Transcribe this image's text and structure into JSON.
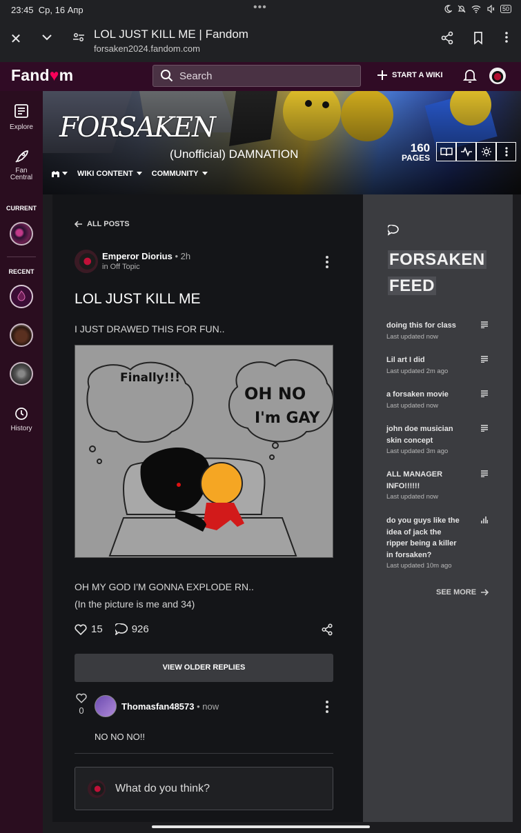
{
  "status": {
    "time": "23:45",
    "date": "Ср, 16 Апр",
    "battery": "50"
  },
  "browser": {
    "title": "LOL JUST KILL ME | Fandom",
    "url": "forsaken2024.fandom.com"
  },
  "fandom": {
    "logo_left": "Fand",
    "logo_right": "m",
    "search_placeholder": "Search",
    "start_wiki": "START A WIKI"
  },
  "rail": {
    "explore": "Explore",
    "fan_central": "Fan Central",
    "current": "CURRENT",
    "recent": "RECENT",
    "history": "History"
  },
  "wiki": {
    "wordmark": "FORSAKEN",
    "name": "(Unofficial) DAMNATION",
    "pages_count": "160",
    "pages_label": "PAGES",
    "nav": [
      "WIKI CONTENT",
      "COMMUNITY"
    ]
  },
  "post": {
    "back": "ALL POSTS",
    "author": "Emperor Diorius",
    "time": "2h",
    "category": "in Off Topic",
    "title": "LOL JUST KILL ME",
    "body1": "I JUST DRAWED THIS FOR FUN..",
    "image_text_left": "Finally!!!",
    "image_text_right_1": "OH NO",
    "image_text_right_2": "I'm GAY",
    "body2_line1": "OH MY GOD I'M GONNA EXPLODE RN..",
    "body2_line2": "(In the picture is me and 34)",
    "likes": "15",
    "comments": "926",
    "view_older": "VIEW OLDER REPLIES"
  },
  "reply": {
    "likes": "0",
    "author": "Thomasfan48573",
    "time": "now",
    "text": "NO NO NO!!"
  },
  "composer": {
    "placeholder": "What do you think?"
  },
  "feed": {
    "title_line1": "FORSAKEN",
    "title_line2": "FEED",
    "items": [
      {
        "title": "doing this for class",
        "updated": "Last updated now",
        "icon": "text-icon"
      },
      {
        "title": "Lil art I did",
        "updated": "Last updated 2m ago",
        "icon": "text-icon"
      },
      {
        "title": "a forsaken movie",
        "updated": "Last updated now",
        "icon": "text-icon"
      },
      {
        "title": "john doe musician skin concept",
        "updated": "Last updated 3m ago",
        "icon": "text-icon"
      },
      {
        "title": "ALL MANAGER INFO!!!!!!",
        "updated": "Last updated now",
        "icon": "text-icon"
      },
      {
        "title": "do you guys like the idea of jack the ripper being a killer in forsaken?",
        "updated": "Last updated 10m ago",
        "icon": "poll-icon"
      }
    ],
    "see_more": "SEE MORE"
  }
}
